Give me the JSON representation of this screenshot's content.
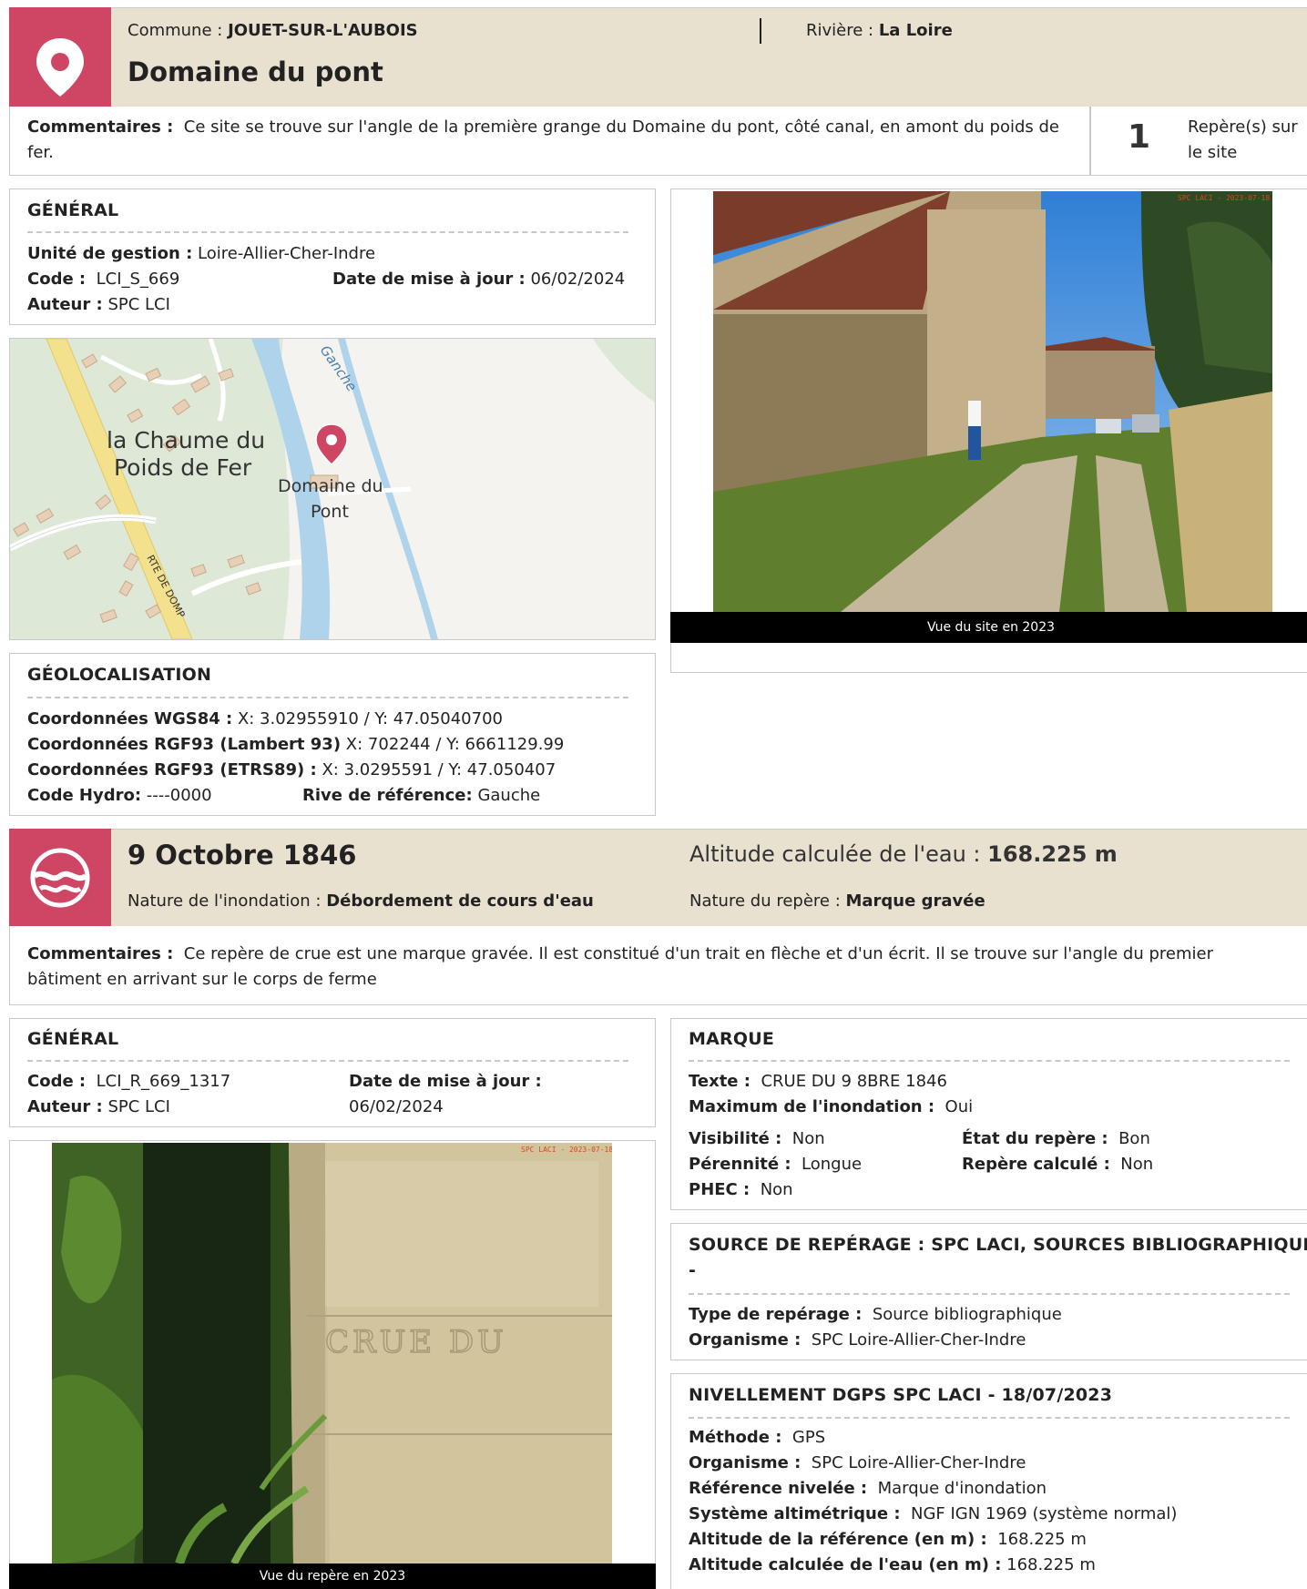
{
  "site": {
    "commune_label": "Commune : ",
    "commune_value": "JOUET-SUR-L'AUBOIS",
    "riviere_label": "Rivière : ",
    "riviere_value": "La Loire",
    "title": "Domaine du pont",
    "comment_label": "Commentaires :",
    "comment_text": "Ce site se trouve sur l'angle de la première grange du Domaine du pont, côté canal, en amont du poids de fer.",
    "count": "1",
    "count_label": "Repère(s) sur le site",
    "icon": "map-pin-icon"
  },
  "general_site": {
    "title": "GÉNÉRAL",
    "unite_label": "Unité de gestion :",
    "unite_value": "Loire-Allier-Cher-Indre",
    "code_label": "Code :",
    "code_value": "LCI_S_669",
    "date_label": "Date de mise à jour :",
    "date_value": "06/02/2024",
    "auteur_label": "Auteur :",
    "auteur_value": "SPC LCI"
  },
  "map": {
    "place_1": "la Chaume du",
    "place_2": "Poids de Fer",
    "marker_1": "Domaine du",
    "marker_2": "Pont",
    "canal": "Ganche",
    "road": "RTE DE DOMP"
  },
  "site_photo": {
    "caption": "Vue du site en 2023",
    "stamp": "SPC LACI - 2023-07-18"
  },
  "geoloc": {
    "title": "GÉOLOCALISATION",
    "wgs_label": "Coordonnées WGS84 :",
    "wgs_value": "X: 3.02955910 / Y: 47.05040700",
    "lambert_label": "Coordonnées RGF93 (Lambert 93)",
    "lambert_value": "X: 702244 / Y: 6661129.99",
    "etrs_label": "Coordonnées RGF93 (ETRS89) :",
    "etrs_value": "X: 3.0295591 / Y: 47.050407",
    "hydro_label": "Code Hydro:",
    "hydro_value": "----0000",
    "rive_label": "Rive de référence:",
    "rive_value": "Gauche"
  },
  "event": {
    "date_title": "9 Octobre 1846",
    "altitude_label": "Altitude calculée de l'eau : ",
    "altitude_value": "168.225 m",
    "nature_label": "Nature de l'inondation : ",
    "nature_value": "Débordement de cours d'eau",
    "repere_label": "Nature du repère : ",
    "repere_value": "Marque gravée",
    "comment_label": "Commentaires :",
    "comment_text": "Ce repère de crue est une marque gravée. Il est constitué d'un trait en flèche et d'un écrit. Il se trouve sur l'angle du premier bâtiment en arrivant sur le corps de ferme",
    "icon": "flood-wave-icon"
  },
  "general_repere": {
    "title": "GÉNÉRAL",
    "code_label": "Code :",
    "code_value": "LCI_R_669_1317",
    "date_label": "Date de mise à jour :",
    "date_value": "06/02/2024",
    "auteur_label": "Auteur :",
    "auteur_value": "SPC LCI"
  },
  "repere_photo": {
    "caption": "Vue du repère en 2023",
    "stamp": "SPC LACI - 2023-07-18",
    "engraving": "CRUE DU"
  },
  "marque": {
    "title": "MARQUE",
    "texte_label": "Texte :",
    "texte_value": "CRUE DU 9 8BRE 1846",
    "max_label": "Maximum de l'inondation :",
    "max_value": "Oui",
    "visibilite_label": "Visibilité :",
    "visibilite_value": "Non",
    "etat_label": "État du repère :",
    "etat_value": "Bon",
    "perennite_label": "Pérennité :",
    "perennite_value": "Longue",
    "calcule_label": "Repère calculé :",
    "calcule_value": "Non",
    "phec_label": "PHEC :",
    "phec_value": "Non"
  },
  "source": {
    "title_1": "SOURCE DE REPÉRAGE : SPC LACI, SOURCES BIBLIOGRAPHIQUES",
    "title_2": "-",
    "type_label": "Type de repérage :",
    "type_value": "Source bibliographique",
    "organisme_label": "Organisme :",
    "organisme_value": "SPC Loire-Allier-Cher-Indre"
  },
  "nivellement": {
    "title": "NIVELLEMENT DGPS SPC LACI - 18/07/2023",
    "methode_label": "Méthode :",
    "methode_value": "GPS",
    "organisme_label": "Organisme :",
    "organisme_value": "SPC Loire-Allier-Cher-Indre",
    "reference_label": "Référence nivelée :",
    "reference_value": "Marque d'inondation",
    "systeme_label": "Système altimétrique :",
    "systeme_value": "NGF IGN 1969 (système normal)",
    "alt_ref_label": "Altitude de la référence (en m) :",
    "alt_ref_value": "168.225 m",
    "alt_eau_label": "Altitude calculée de l'eau (en m) :",
    "alt_eau_value": "168.225 m"
  },
  "colors": {
    "accent": "#cf4665",
    "header_band": "#e8e1d0",
    "border": "#c9c9c9"
  }
}
